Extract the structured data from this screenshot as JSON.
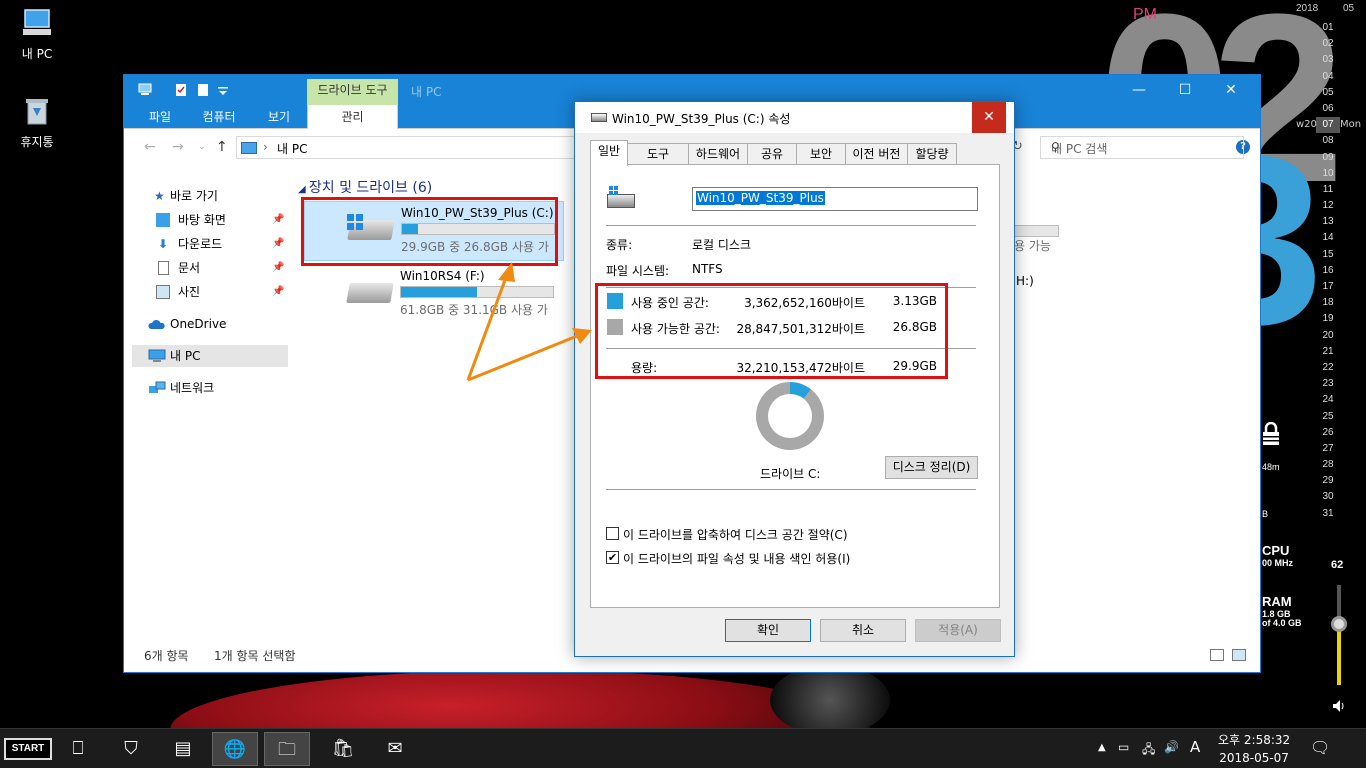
{
  "desktop": {
    "icons": [
      {
        "label": "내 PC"
      },
      {
        "label": "휴지통"
      }
    ],
    "clock_widget": {
      "period": "PM",
      "hour": "02",
      "minute_digit": "3",
      "year": "2018",
      "month": "05",
      "week": "w20",
      "weekday": "Mon",
      "days": [
        "01",
        "02",
        "03",
        "04",
        "05",
        "06",
        "07",
        "08",
        "09",
        "10",
        "11",
        "12",
        "13",
        "14",
        "15",
        "16",
        "17",
        "18",
        "19",
        "20",
        "21",
        "22",
        "23",
        "24",
        "25",
        "26",
        "27",
        "28",
        "29",
        "30",
        "31"
      ],
      "today": "07"
    },
    "side_fragments": {
      "cpu_label": "CPU",
      "cpu_freq": "00 MHz",
      "ram_label": "RAM",
      "ram_used": "1.8 GB",
      "ram_total": "of 4.0 GB",
      "uptime_frag": "48m",
      "b_frag": "B",
      "volume": "62"
    }
  },
  "explorer": {
    "title": "내 PC",
    "drive_tools": "드라이브 도구",
    "ribbon_tabs": [
      "파일",
      "컴퓨터",
      "보기"
    ],
    "manage_tab": "관리",
    "address": "내 PC",
    "search_placeholder": "내 PC 검색",
    "nav": {
      "quick_access": "바로 가기",
      "desktop": "바탕 화면",
      "downloads": "다운로드",
      "documents": "문서",
      "pictures": "사진",
      "onedrive": "OneDrive",
      "this_pc": "내 PC",
      "network": "네트워크"
    },
    "section_title": "장치 및 드라이브",
    "section_count": "(6)",
    "drives": [
      {
        "name": "Win10_PW_St39_Plus (C:)",
        "size": "29.9GB 중 26.8GB 사용 가",
        "used_fraction": 0.105
      },
      {
        "name": "Win10RS4 (F:)",
        "size": "61.8GB 중 31.1GB 사용 가",
        "used_fraction": 0.5
      }
    ],
    "right_fragments": {
      "avail": "용 가능",
      "drive": "H:)"
    },
    "status": {
      "items": "6개 항목",
      "selected": "1개 항목 선택함"
    }
  },
  "dialog": {
    "title": "Win10_PW_St39_Plus (C:) 속성",
    "tabs": [
      "일반",
      "도구",
      "하드웨어",
      "공유",
      "보안",
      "이전 버전",
      "할당량"
    ],
    "volume_name": "Win10_PW_St39_Plus",
    "type_label": "종류:",
    "type_value": "로컬 디스크",
    "fs_label": "파일 시스템:",
    "fs_value": "NTFS",
    "used_label": "사용 중인 공간:",
    "used_bytes": "3,362,652,160바이트",
    "used_gb": "3.13GB",
    "free_label": "사용 가능한 공간:",
    "free_bytes": "28,847,501,312바이트",
    "free_gb": "26.8GB",
    "capacity_label": "용량:",
    "capacity_bytes": "32,210,153,472바이트",
    "capacity_gb": "29.9GB",
    "used_fraction": 0.105,
    "drive_label": "드라이브 C:",
    "cleanup_button": "디스크 정리(D)",
    "compress_label": "이 드라이브를 압축하여 디스크 공간 절약(C)",
    "compress_checked": false,
    "index_label": "이 드라이브의 파일 속성 및 내용 색인 허용(I)",
    "index_checked": true,
    "ok": "확인",
    "cancel": "취소",
    "apply": "적용(A)",
    "colors": {
      "used": "#26a0da",
      "free": "#a8a8a8",
      "highlight": "#e01010",
      "arrow": "#f08a10"
    }
  },
  "taskbar": {
    "start": "START",
    "time": "오후 2:58:32",
    "date": "2018-05-07",
    "ime": "A"
  }
}
